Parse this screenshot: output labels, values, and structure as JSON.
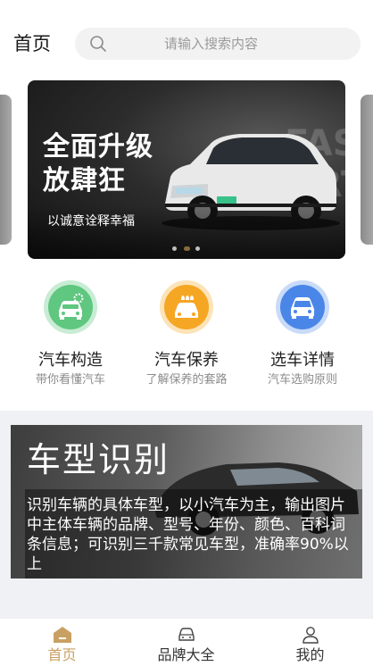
{
  "header": {
    "title": "首页",
    "search_placeholder": "请输入搜索内容"
  },
  "banner": {
    "headline": "全面升级 放肆狂",
    "subtext": "以诚意诠释幸福",
    "background_text": "FASH ORT",
    "slide_count": 3,
    "active_slide": 2
  },
  "features": [
    {
      "title": "汽车构造",
      "subtitle": "带你看懂汽车",
      "icon": "car-gear-icon",
      "color": "#5fc77f"
    },
    {
      "title": "汽车保养",
      "subtitle": "了解保养的套路",
      "icon": "car-wash-icon",
      "color": "#f5a623"
    },
    {
      "title": "选车详情",
      "subtitle": "汽车选购原则",
      "icon": "car-front-icon",
      "color": "#4a86e8"
    }
  ],
  "recognition": {
    "title": "车型识别",
    "description": "识别车辆的具体车型，以小汽车为主，输出图片中主体车辆的品牌、型号、年份、颜色、百科词条信息；可识别三千款常见车型，准确率90%以上"
  },
  "tabbar": {
    "items": [
      {
        "label": "首页",
        "icon": "home-icon",
        "active": true
      },
      {
        "label": "品牌大全",
        "icon": "car-icon",
        "active": false
      },
      {
        "label": "我的",
        "icon": "user-icon",
        "active": false
      }
    ],
    "active_color": "#c9a063",
    "inactive_color": "#333333"
  }
}
